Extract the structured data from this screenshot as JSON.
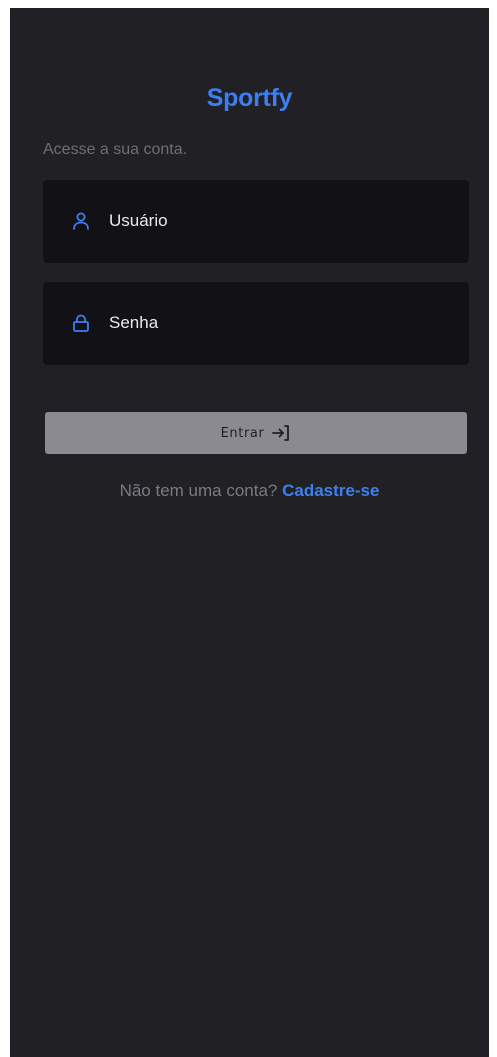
{
  "colors": {
    "accent": "#3d7ff2",
    "background": "#202025",
    "field_background": "#121216",
    "button_background": "#8b8a91"
  },
  "header": {
    "brand": "Sportfy",
    "subtitle": "Acesse a sua conta."
  },
  "form": {
    "username": {
      "placeholder": "Usuário",
      "value": "",
      "icon": "user-icon"
    },
    "password": {
      "placeholder": "Senha",
      "value": "",
      "icon": "lock-icon"
    },
    "submit": {
      "label": "Entrar",
      "icon": "login-arrow-icon"
    }
  },
  "footer": {
    "prompt": "Não tem uma conta?",
    "signup_link": "Cadastre-se"
  }
}
